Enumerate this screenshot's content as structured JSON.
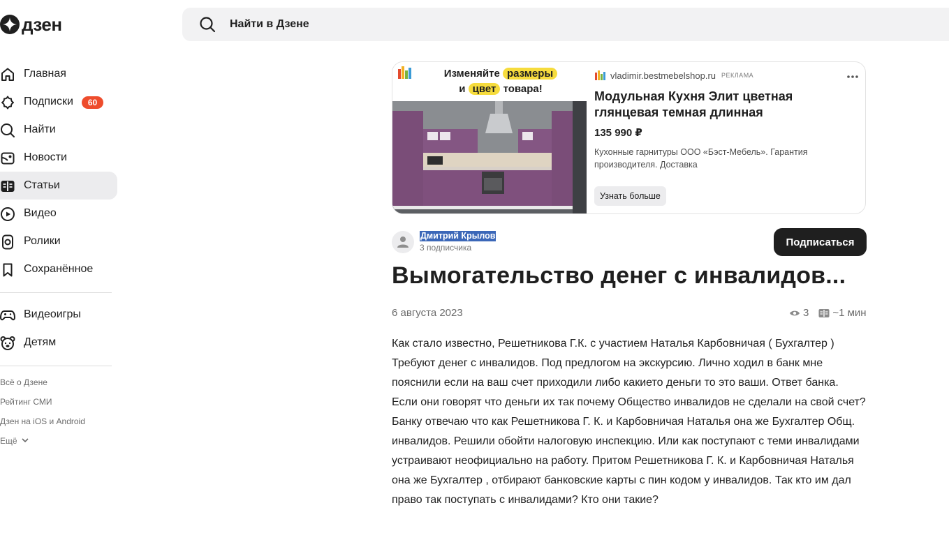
{
  "logo": {
    "text": "дзен"
  },
  "search": {
    "placeholder": "Найти в Дзене"
  },
  "nav": {
    "items": [
      {
        "label": "Главная"
      },
      {
        "label": "Подписки",
        "badge": "60"
      },
      {
        "label": "Найти"
      },
      {
        "label": "Новости"
      },
      {
        "label": "Статьи",
        "active": true
      },
      {
        "label": "Видео"
      },
      {
        "label": "Ролики"
      },
      {
        "label": "Сохранённое"
      }
    ],
    "secondary": [
      {
        "label": "Видеоигры"
      },
      {
        "label": "Детям"
      }
    ],
    "footer": [
      {
        "label": "Всё о Дзене"
      },
      {
        "label": "Рейтинг СМИ"
      },
      {
        "label": "Дзен на iOS и Android"
      },
      {
        "label": "Ещё"
      }
    ]
  },
  "ad": {
    "headline": {
      "line1_pre": "Изменяйте",
      "line1_hl": "размеры",
      "line2_pre": "и",
      "line2_hl": "цвет",
      "line2_post": "товара!"
    },
    "domain": "vladimir.bestmebelshop.ru",
    "tag": "РЕКЛАМА",
    "title": "Модульная Кухня Элит цветная глянцевая темная длинная",
    "price": "135 990 ₽",
    "description": "Кухонные гарнитуры ООО «Бэст-Мебель». Гарантия производителя. Доставка",
    "button": "Узнать больше"
  },
  "author": {
    "name": "Дмитрий Крылов",
    "subscribers": "3 подписчика",
    "subscribe_label": "Подписаться"
  },
  "article": {
    "title": "Вымогательство денег с инвалидов...",
    "date": "6 августа 2023",
    "views": "3",
    "read_time": "~1 мин",
    "body": "Как стало известно, Решетникова Г.К. с участием Наталья Карбовничая ( Бухгалтер ) Требуют денег с инвалидов. Под предлогом на экскурсию. Лично ходил в банк мне пояснили если на ваш счет приходили либо какието деньги то это ваши. Ответ банка. Если они говорят что деньги их так почему Общество инвалидов не сделали на свой счет? Банку отвечаю что как Решетникова Г. К. и Карбовничая Наталья она же Бухгалтер Общ. инвалидов. Решили обойти налоговую инспекцию. Или как поступают с теми инвалидами устраивают неофициально на работу. Притом Решетникова Г. К. и Карбовничая Наталья она же Бухгалтер , отбирают банковские карты с пин кодом у инвалидов. Так кто им дал право так поступать с инвалидами? Кто они такие?"
  },
  "colors": {
    "accent_badge": "#ee4c2c",
    "highlight": "#f6dc3d",
    "selection": "#3b67b8",
    "primary_button": "#1f1f1f"
  }
}
